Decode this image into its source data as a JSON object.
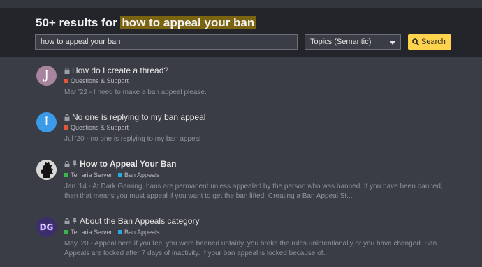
{
  "header": {
    "results_prefix": "50+ results for ",
    "query_highlight": "how to appeal your ban",
    "search_value": "how to appeal your ban",
    "scope_select": "Topics (Semantic)",
    "search_button": "Search"
  },
  "colors": {
    "accent_button": "#ffd34e",
    "highlight": "#7a6410",
    "category_red": "#e45735",
    "category_green": "#3ab54a",
    "category_blue": "#25aae2"
  },
  "results": [
    {
      "avatar_letter": "J",
      "avatar_color": "#a7859f",
      "title": "How do I create a thread?",
      "icons": [
        "lock-icon"
      ],
      "categories": [
        {
          "name": "Questions & Support",
          "color": "#e45735"
        }
      ],
      "date": "Mar '22",
      "blurb": " - I need to make a ban appeal please."
    },
    {
      "avatar_letter": "I",
      "avatar_color": "#3b9be8",
      "title": "No one is replying to my ban appeal",
      "icons": [
        "lock-icon"
      ],
      "categories": [
        {
          "name": "Questions & Support",
          "color": "#e45735"
        }
      ],
      "date": "Jul '20",
      "blurb": " - no one is replying to my ban appeal"
    },
    {
      "avatar_letter": "",
      "avatar_color": "#d8d8d8",
      "title": "How to Appeal Your Ban",
      "icons": [
        "lock-icon",
        "pin-icon"
      ],
      "categories": [
        {
          "name": "Terraria Server",
          "color": "#3ab54a"
        },
        {
          "name": "Ban Appeals",
          "color": "#25aae2"
        }
      ],
      "date": "Jan '14",
      "blurb": " - At Dark Gaming, bans are permanent unless appealed by the person who was banned. If you have been banned, then that means you must appeal if you want to get the ban lifted. Creating a Ban Appeal St..."
    },
    {
      "avatar_letter": "DG",
      "avatar_color": "#3c2d6b",
      "title": "About the Ban Appeals category",
      "icons": [
        "lock-icon",
        "pin-icon"
      ],
      "categories": [
        {
          "name": "Terraria Server",
          "color": "#3ab54a"
        },
        {
          "name": "Ban Appeals",
          "color": "#25aae2"
        }
      ],
      "date": "May '20",
      "blurb": " - Appeal here if you feel you were banned unfairly, you broke the rules unintentionally or you have changed. Ban Appeals are locked after 7 days of inactivity. If your ban appeal is locked because of..."
    }
  ]
}
